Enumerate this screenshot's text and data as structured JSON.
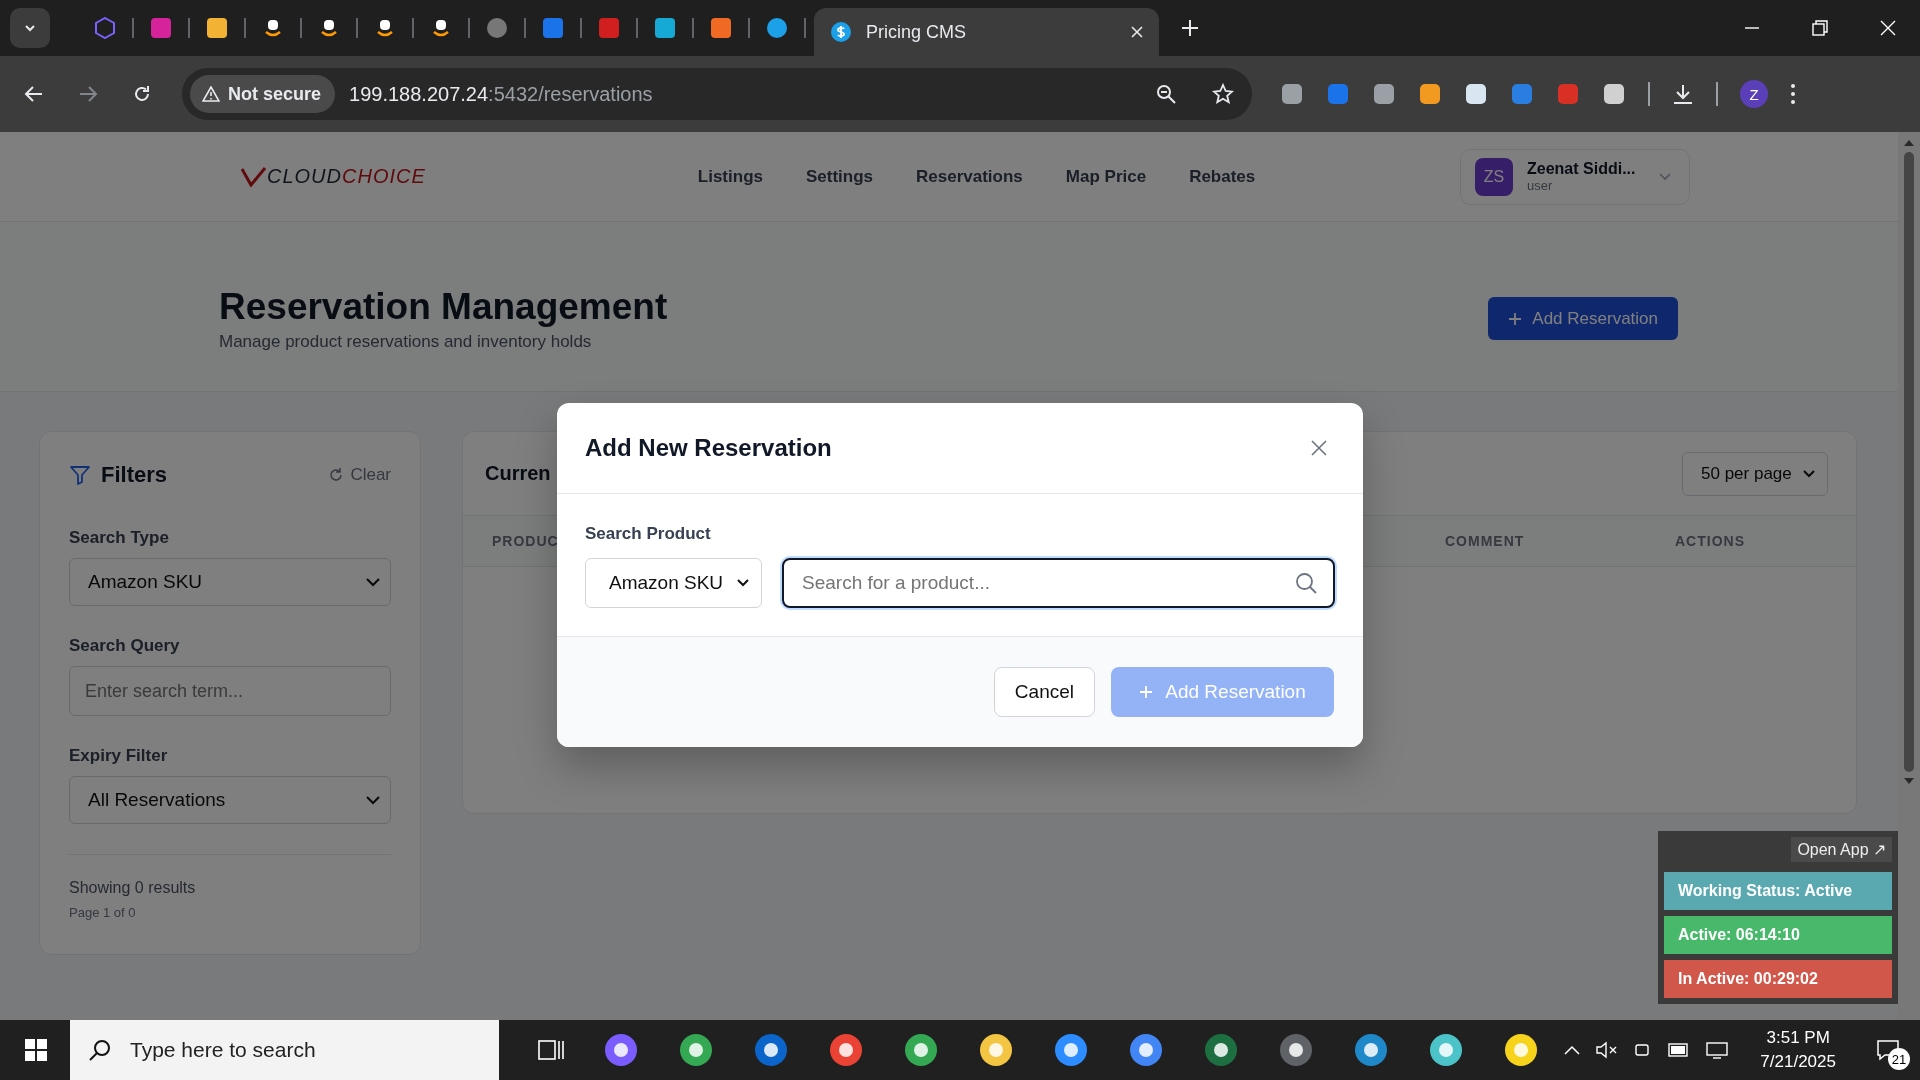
{
  "browser": {
    "tabs": [
      {
        "title": "Pricing CMS",
        "selected": true
      }
    ],
    "security": "Not secure",
    "host": "199.188.207.24",
    "path": ":5432/reservations",
    "profile": "Z"
  },
  "app": {
    "logo": {
      "first": "CLOUD",
      "second": "CHOICE"
    },
    "nav": [
      "Listings",
      "Settings",
      "Reservations",
      "Map Price",
      "Rebates"
    ],
    "user": {
      "initials": "ZS",
      "name": "Zeenat Siddi...",
      "role": "user"
    }
  },
  "page": {
    "title": "Reservation Management",
    "subtitle": "Manage product reservations and inventory holds",
    "add_button": "Add Reservation"
  },
  "filters": {
    "title": "Filters",
    "clear": "Clear",
    "fields": [
      {
        "kind": "select",
        "label": "Search Type",
        "value": "Amazon SKU"
      },
      {
        "kind": "input",
        "label": "Search Query",
        "placeholder": "Enter search term..."
      },
      {
        "kind": "select",
        "label": "Expiry Filter",
        "value": "All Reservations"
      }
    ],
    "summary": "Showing 0 results",
    "page_info": "Page 1 of 0"
  },
  "table": {
    "title": "Curren",
    "per_page": "50 per page",
    "columns": [
      "PRODUC",
      "COMMENT",
      "ACTIONS"
    ]
  },
  "modal": {
    "title": "Add New Reservation",
    "label": "Search Product",
    "type": "Amazon SKU",
    "placeholder": "Search for a product...",
    "cancel": "Cancel",
    "submit": {
      "label": "Add Reservation",
      "disabled": true
    }
  },
  "widget": {
    "open_app": "Open App ↗",
    "rows": [
      {
        "text": "Working Status: Active",
        "color": "#5aa9b0"
      },
      {
        "text": "Active: 06:14:10",
        "color": "#48b96a"
      },
      {
        "text": "In Active: 00:29:02",
        "color": "#d1574a"
      }
    ]
  },
  "taskbar": {
    "search": "Type here to search",
    "time": "3:51 PM",
    "date": "7/21/2025",
    "notifications": "21"
  }
}
